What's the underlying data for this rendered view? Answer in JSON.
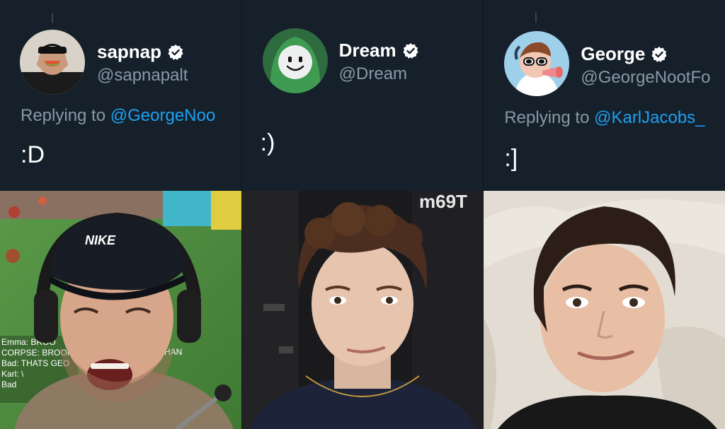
{
  "tweets": [
    {
      "name": "sapnap",
      "handle": "@sapnapalt",
      "replying_prefix": "Replying to",
      "replying_to": "@GeorgeNoo",
      "text": ":D",
      "verified": true,
      "avatar_icon": "watermelon-avatar"
    },
    {
      "name": "Dream",
      "handle": "@Dream",
      "replying_prefix": "",
      "replying_to": "",
      "text": ":)",
      "verified": true,
      "avatar_icon": "smiley-mask-avatar"
    },
    {
      "name": "George",
      "handle": "@GeorgeNootFo",
      "replying_prefix": "Replying to",
      "replying_to": "@KarlJacobs_",
      "text": ":]",
      "verified": true,
      "avatar_icon": "cartoon-sunglasses-avatar"
    }
  ],
  "photo_overlay": {
    "chat_lines": [
      "Emma: BROO",
      "CORPSE: BROOI",
      "Bad: THATS GEO",
      "Karl: \\",
      "Bad"
    ],
    "chat_suffix": "HAN",
    "bg_sign_text": "m69T",
    "hat_logo_text": "NIKE"
  },
  "colors": {
    "background": "#15202b",
    "name": "#ffffff",
    "secondary_text": "#8899a6",
    "mention": "#1da1f2",
    "verified_badge": "#ffffff"
  }
}
